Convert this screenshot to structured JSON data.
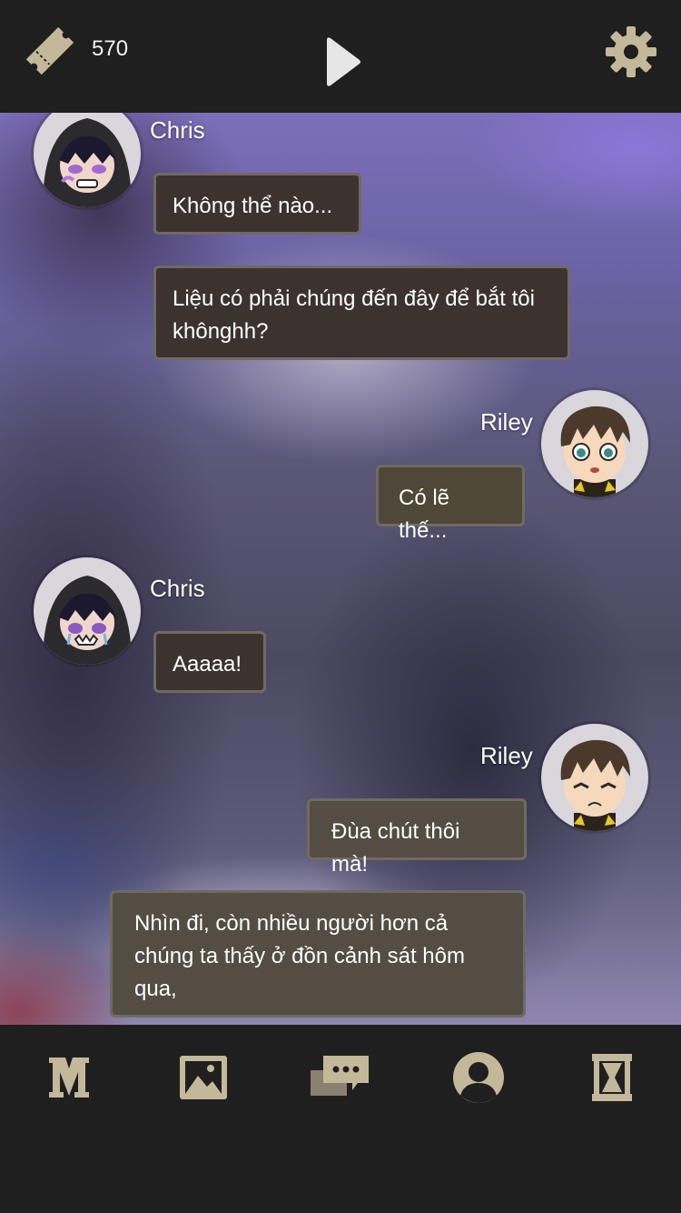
{
  "header": {
    "tickets_count": "570",
    "ticket_icon": "ticket-icon",
    "play_icon": "play-icon",
    "settings_icon": "gear-icon"
  },
  "messages": [
    {
      "speaker": "Chris",
      "side": "left",
      "text": "Không thể nào..."
    },
    {
      "speaker": "Chris",
      "side": "left",
      "text": "Liệu có phải chúng đến đây để bắt tôi khônghh?"
    },
    {
      "speaker": "Riley",
      "side": "right",
      "text": "Có lẽ thế..."
    },
    {
      "speaker": "Chris",
      "side": "left",
      "text": "Aaaaa!"
    },
    {
      "speaker": "Riley",
      "side": "right",
      "text": "Đùa chút thôi mà!"
    },
    {
      "speaker": "Riley",
      "side": "right",
      "text": "Nhìn đi, còn nhiều người hơn cả chúng ta thấy ở đồn cảnh sát hôm qua,"
    }
  ],
  "speakers": {
    "chris": "Chris",
    "riley": "Riley"
  },
  "bottom_nav": [
    {
      "icon": "menu-m-icon"
    },
    {
      "icon": "gallery-icon"
    },
    {
      "icon": "chat-log-icon"
    },
    {
      "icon": "profile-icon"
    },
    {
      "icon": "hourglass-icon"
    }
  ],
  "colors": {
    "bar_bg": "#1f1f1f",
    "icon_tan": "#c4b89a",
    "bubble_dark": "#3c322f",
    "bubble_olive": "#4f4738"
  }
}
